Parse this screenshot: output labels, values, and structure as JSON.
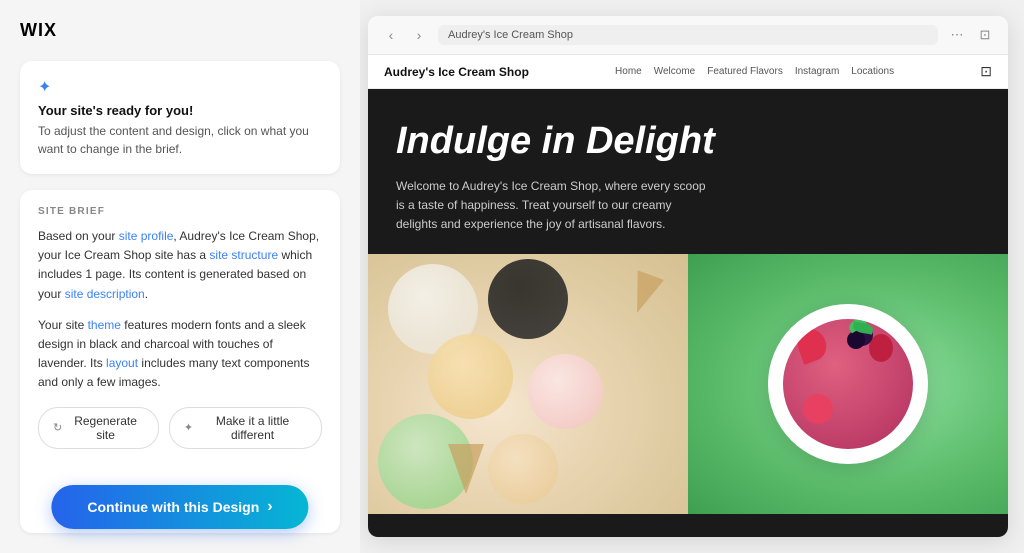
{
  "app": {
    "logo": "WIX"
  },
  "left_panel": {
    "info_card": {
      "icon": "✦",
      "title": "Your site's ready for you!",
      "subtitle": "To adjust the content and design, click on what you want to change in the brief."
    },
    "site_brief": {
      "label": "SITE BRIEF",
      "paragraph1_prefix": "Based on your ",
      "link1": "site profile",
      "paragraph1_middle": ", Audrey's Ice Cream Shop, your Ice Cream Shop site has a ",
      "link2": "site structure",
      "paragraph1_suffix": " which includes 1 page. Its content is generated based on your ",
      "link3": "site description",
      "paragraph1_end": ".",
      "paragraph2_prefix": "Your site ",
      "link4": "theme",
      "paragraph2_middle": " features modern fonts and a sleek design in black and charcoal with touches of lavender. Its ",
      "link5": "layout",
      "paragraph2_suffix": " includes many text components and only a few images."
    },
    "actions": {
      "regenerate_label": "Regenerate site",
      "make_different_label": "Make it a little different"
    },
    "continue_button": "Continue with this Design"
  },
  "browser": {
    "back_arrow": "‹",
    "forward_arrow": "›",
    "address": "Audrey's Ice Cream Shop",
    "nav_icon": "🔒"
  },
  "website": {
    "site_name": "Audrey's Ice Cream Shop",
    "nav_links": [
      "Home",
      "Welcome",
      "Featured Flavors",
      "Instagram",
      "Locations"
    ],
    "hero_title": "Indulge in Delight",
    "hero_subtitle": "Welcome to Audrey's Ice Cream Shop, where every scoop is a taste of happiness. Treat yourself to our creamy delights and experience the joy of artisanal flavors."
  }
}
